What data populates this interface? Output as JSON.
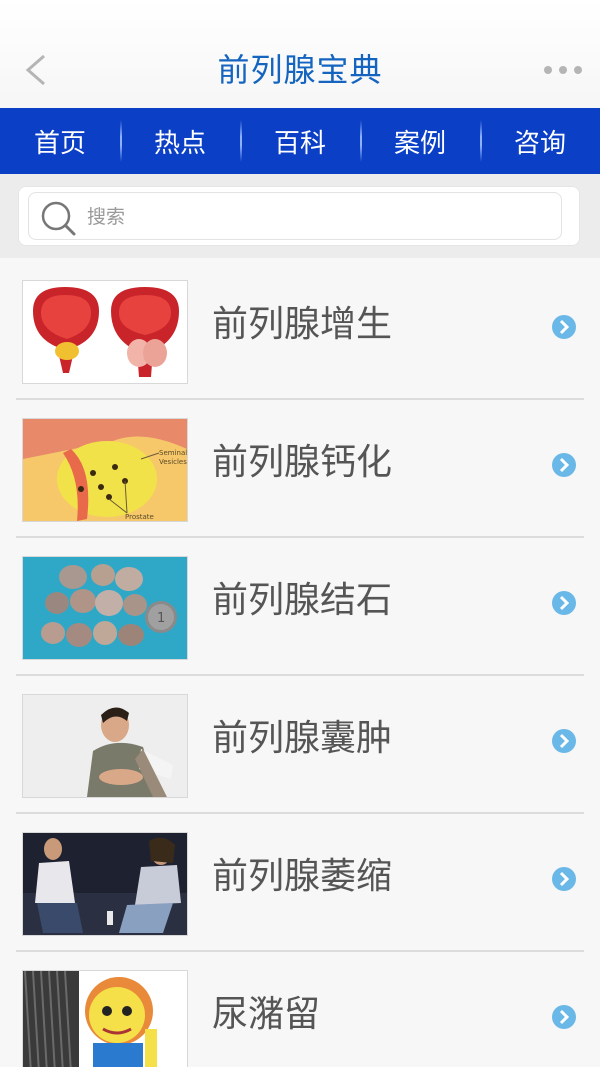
{
  "header": {
    "title": "前列腺宝典",
    "back_icon": "chevron-left-icon",
    "more_icon": "more-dots-icon"
  },
  "nav": {
    "tabs": [
      {
        "label": "首页"
      },
      {
        "label": "热点"
      },
      {
        "label": "百科"
      },
      {
        "label": "案例"
      },
      {
        "label": "咨询"
      }
    ],
    "background": "#0a3fc6"
  },
  "search": {
    "placeholder": "搜索",
    "value": "",
    "icon": "search-icon"
  },
  "list": {
    "items": [
      {
        "label": "前列腺增生",
        "thumb": "prostate-anatomy-image"
      },
      {
        "label": "前列腺钙化",
        "thumb": "prostate-calcification-image"
      },
      {
        "label": "前列腺结石",
        "thumb": "prostate-stones-image"
      },
      {
        "label": "前列腺囊肿",
        "thumb": "man-in-discomfort-image"
      },
      {
        "label": "前列腺萎缩",
        "thumb": "couple-on-sofa-image"
      },
      {
        "label": "尿潴留",
        "thumb": "cartoon-character-image"
      }
    ],
    "thumb_labels": {
      "seminal_vesicles_line1": "Seminal",
      "seminal_vesicles_line2": "Vesicles",
      "prostate": "Prostate",
      "coin": "1"
    },
    "chevron_icon": "chevron-right-circle-icon",
    "chevron_color": "#6ab8e8"
  },
  "colors": {
    "title": "#1565c0",
    "accent": "#0a3fc6",
    "item_text": "#555555"
  }
}
